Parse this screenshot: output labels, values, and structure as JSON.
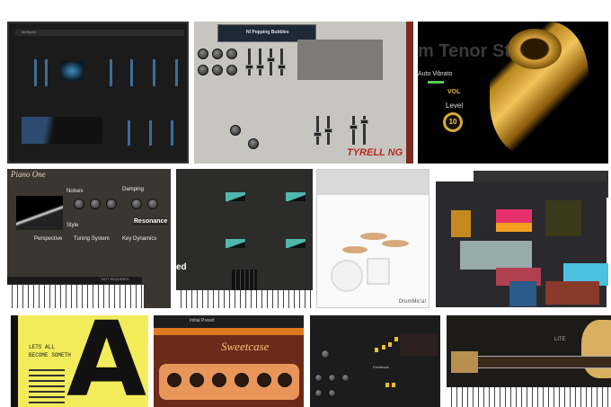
{
  "tiles": {
    "synth_dark": {
      "title": "MeSynth"
    },
    "tyrell": {
      "preset": "NI Popping Bubbles",
      "logo": "TYRELL NG"
    },
    "sax": {
      "watermark": "m Tenor Studio",
      "vibrato": "Auto Vibrato",
      "vol": "VOL",
      "level": "Level",
      "level_value": "10"
    },
    "piano_one": {
      "logo": "Piano One",
      "noises": "Noises",
      "damping": "Damping",
      "style": "Style",
      "resonance": "Resonance",
      "perspective": "Perspective",
      "tuning": "Tuning System",
      "key_dynamics": "Key Dynamics",
      "not_required": "NOT REQUIRED"
    },
    "modular": {
      "label": "ed"
    },
    "drums": {
      "logo": "DrumMic'a!"
    },
    "collage": {},
    "typewriter": {
      "line1": "LETS ALL",
      "line2": "BECOME SOMETH",
      "big_letter": "A"
    },
    "sweetcase": {
      "preset": "Initial Preset",
      "logo": "Sweetcase"
    },
    "dark_fx": {
      "label": "Feedback"
    },
    "guitar": {
      "logo": "LITE"
    }
  }
}
